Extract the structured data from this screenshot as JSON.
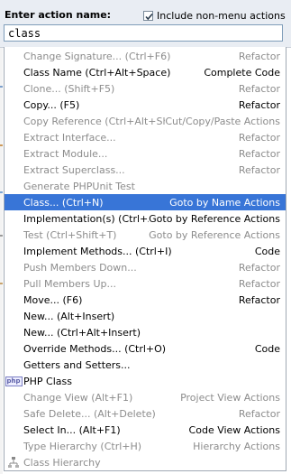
{
  "header": {
    "title": "Enter action name:",
    "include_non_menu_label": "Include non-menu actions",
    "include_non_menu_checked": true
  },
  "search": {
    "value": "class"
  },
  "actions": [
    {
      "label": "Change Signature... (Ctrl+F6)",
      "group": "Refactor",
      "enabled": false,
      "selected": false,
      "icon": ""
    },
    {
      "label": "Class Name (Ctrl+Alt+Space)",
      "group": "Complete Code",
      "enabled": true,
      "selected": false,
      "icon": ""
    },
    {
      "label": "Clone... (Shift+F5)",
      "group": "Refactor",
      "enabled": false,
      "selected": false,
      "icon": ""
    },
    {
      "label": "Copy... (F5)",
      "group": "Refactor",
      "enabled": true,
      "selected": false,
      "icon": ""
    },
    {
      "label": "Copy Reference (Ctrl+Alt+Shift+C)",
      "group": "Cut/Copy/Paste Actions",
      "enabled": false,
      "selected": false,
      "icon": ""
    },
    {
      "label": "Extract Interface...",
      "group": "Refactor",
      "enabled": false,
      "selected": false,
      "icon": ""
    },
    {
      "label": "Extract Module...",
      "group": "Refactor",
      "enabled": false,
      "selected": false,
      "icon": ""
    },
    {
      "label": "Extract Superclass...",
      "group": "Refactor",
      "enabled": false,
      "selected": false,
      "icon": ""
    },
    {
      "label": "Generate PHPUnit Test",
      "group": "",
      "enabled": false,
      "selected": false,
      "icon": ""
    },
    {
      "label": "Class... (Ctrl+N)",
      "group": "Goto by Name Actions",
      "enabled": true,
      "selected": true,
      "icon": ""
    },
    {
      "label": "Implementation(s) (Ctrl+Alt+B)",
      "group": "Goto by Reference Actions",
      "enabled": true,
      "selected": false,
      "icon": ""
    },
    {
      "label": "Test (Ctrl+Shift+T)",
      "group": "Goto by Reference Actions",
      "enabled": false,
      "selected": false,
      "icon": ""
    },
    {
      "label": "Implement Methods... (Ctrl+I)",
      "group": "Code",
      "enabled": true,
      "selected": false,
      "icon": ""
    },
    {
      "label": "Push Members Down...",
      "group": "Refactor",
      "enabled": false,
      "selected": false,
      "icon": ""
    },
    {
      "label": "Pull Members Up...",
      "group": "Refactor",
      "enabled": false,
      "selected": false,
      "icon": ""
    },
    {
      "label": "Move... (F6)",
      "group": "Refactor",
      "enabled": true,
      "selected": false,
      "icon": ""
    },
    {
      "label": "New... (Alt+Insert)",
      "group": "",
      "enabled": true,
      "selected": false,
      "icon": ""
    },
    {
      "label": "New... (Ctrl+Alt+Insert)",
      "group": "",
      "enabled": true,
      "selected": false,
      "icon": ""
    },
    {
      "label": "Override Methods... (Ctrl+O)",
      "group": "Code",
      "enabled": true,
      "selected": false,
      "icon": ""
    },
    {
      "label": "Getters and Setters...",
      "group": "",
      "enabled": true,
      "selected": false,
      "icon": ""
    },
    {
      "label": "PHP Class",
      "group": "",
      "enabled": true,
      "selected": false,
      "icon": "php-icon"
    },
    {
      "label": "Change View (Alt+F1)",
      "group": "Project View Actions",
      "enabled": false,
      "selected": false,
      "icon": ""
    },
    {
      "label": "Safe Delete... (Alt+Delete)",
      "group": "Refactor",
      "enabled": false,
      "selected": false,
      "icon": ""
    },
    {
      "label": "Select In... (Alt+F1)",
      "group": "Code View Actions",
      "enabled": true,
      "selected": false,
      "icon": ""
    },
    {
      "label": "Type Hierarchy (Ctrl+H)",
      "group": "Hierarchy Actions",
      "enabled": false,
      "selected": false,
      "icon": ""
    },
    {
      "label": "Class Hierarchy",
      "group": "",
      "enabled": false,
      "selected": false,
      "icon": "hierarchy-icon"
    }
  ],
  "colors": {
    "selection": "#3875d7",
    "disabled_text": "#8c8c8c",
    "header_bg": "#e9edf3"
  }
}
